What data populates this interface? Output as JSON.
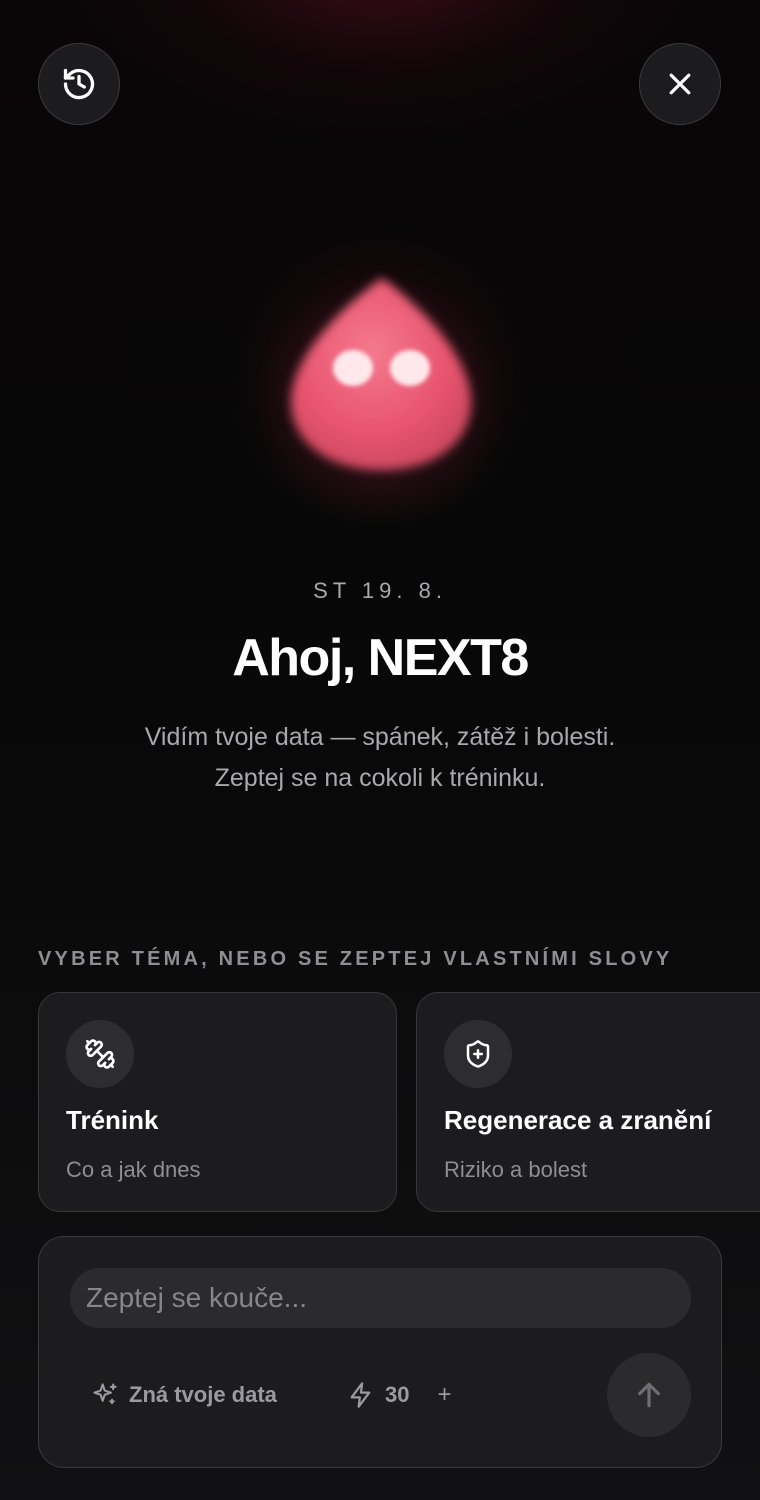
{
  "header": {
    "history_icon": "history-icon",
    "close_icon": "close-icon"
  },
  "mascot": {
    "color": "#e8546f"
  },
  "date": "ST 19. 8.",
  "greeting": "Ahoj, NEXT8",
  "subtitle": {
    "line1": "Vidím tvoje data — spánek, zátěž i bolesti.",
    "line2": "Zeptej se na cokoli k tréninku."
  },
  "section_label": "VYBER TÉMA, NEBO SE ZEPTEJ VLASTNÍMI SLOVY",
  "topics": [
    {
      "icon": "dumbbell-icon",
      "title": "Trénink",
      "desc": "Co a jak dnes"
    },
    {
      "icon": "shield-plus-icon",
      "title": "Regenerace a zranění",
      "desc": "Riziko a bolest"
    }
  ],
  "composer": {
    "placeholder": "Zeptej se kouče...",
    "value": "",
    "data_chip": "Zná tvoje data",
    "credits": "30",
    "credits_plus": "+",
    "send_icon": "arrow-up-icon"
  }
}
